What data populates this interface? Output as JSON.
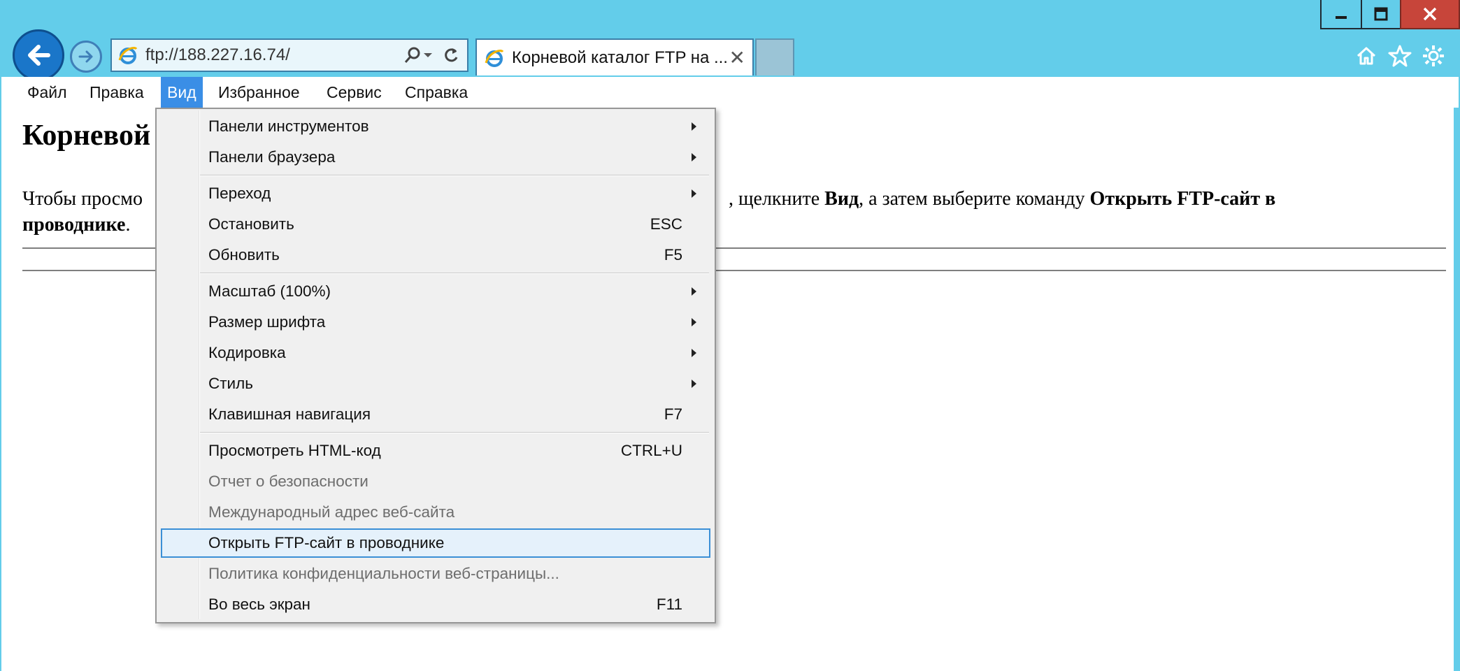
{
  "browser": {
    "address": "ftp://188.227.16.74/",
    "tab_title": "Корневой каталог FTP на ...",
    "tab_close": "✕"
  },
  "window_controls": {
    "minimize": "minimize-icon",
    "maximize": "maximize-icon",
    "close": "close-icon"
  },
  "menubar": {
    "file": "Файл",
    "edit": "Правка",
    "view": "Вид",
    "favorites": "Избранное",
    "tools": "Сервис",
    "help": "Справка"
  },
  "page": {
    "title_visible": "Корневой",
    "text_left": "Чтобы просмо",
    "text_right_1": ", щелкните ",
    "text_bold_view": "Вид",
    "text_right_2": ", а затем выберите команду ",
    "text_bold_open": "Открыть FTP-сайт в",
    "text_line2_bold": "проводнике",
    "text_line2_end": "."
  },
  "view_menu": {
    "items": [
      {
        "label": "Панели инструментов",
        "submenu": true
      },
      {
        "label": "Панели браузера",
        "submenu": true
      },
      {
        "label": "Переход",
        "submenu": true
      },
      {
        "label": "Остановить",
        "shortcut": "ESC"
      },
      {
        "label": "Обновить",
        "shortcut": "F5"
      },
      {
        "label": "Масштаб (100%)",
        "submenu": true
      },
      {
        "label": "Размер шрифта",
        "submenu": true
      },
      {
        "label": "Кодировка",
        "submenu": true
      },
      {
        "label": "Стиль",
        "submenu": true
      },
      {
        "label": "Клавишная навигация",
        "shortcut": "F7"
      },
      {
        "label": "Просмотреть HTML-код",
        "shortcut": "CTRL+U"
      },
      {
        "label": "Отчет о безопасности",
        "disabled": true
      },
      {
        "label": "Международный адрес веб-сайта",
        "disabled": true
      },
      {
        "label": "Открыть FTP-сайт в проводнике",
        "highlighted": true
      },
      {
        "label": "Политика конфиденциальности веб-страницы...",
        "disabled": true
      },
      {
        "label": "Во весь экран",
        "shortcut": "F11"
      }
    ]
  },
  "colors": {
    "frame": "#63cdea",
    "menu_highlight_bg": "#e5f1fb",
    "menu_highlight_border": "#3b8fd6",
    "active_menubar": "#3a8ee6",
    "close_button": "#c7453a"
  }
}
